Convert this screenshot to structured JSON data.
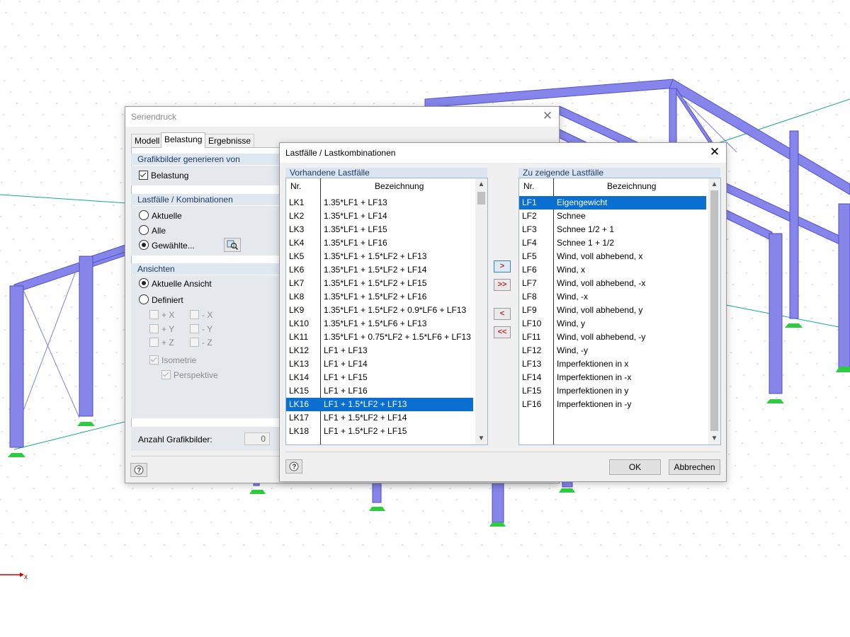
{
  "background": {
    "axis_label": "x",
    "colors": {
      "beam": "#7f7fe8",
      "support": "#2ecc40",
      "axis": "#d00000"
    }
  },
  "seriendruck": {
    "title": "Seriendruck",
    "tabs": [
      {
        "label": "Modell",
        "active": false
      },
      {
        "label": "Belastung",
        "active": true
      },
      {
        "label": "Ergebnisse",
        "active": false
      }
    ],
    "grafikbilder": {
      "header": "Grafikbilder generieren von",
      "belastung_label": "Belastung",
      "belastung_checked": true
    },
    "lastfaelle": {
      "header": "Lastfälle / Kombinationen",
      "options": [
        "Aktuelle",
        "Alle",
        "Gewählte..."
      ],
      "selected": "Gewählte..."
    },
    "ansichten": {
      "header": "Ansichten",
      "aktuelle": "Aktuelle Ansicht",
      "definiert": "Definiert",
      "selected": "Aktuelle Ansicht",
      "dirs": [
        [
          "+ X",
          "- X"
        ],
        [
          "+ Y",
          "- Y"
        ],
        [
          "+ Z",
          "- Z"
        ]
      ],
      "isometrie": "Isometrie",
      "perspektive": "Perspektive"
    },
    "anzahl_label": "Anzahl Grafikbilder:",
    "anzahl_value": "0"
  },
  "lastfaelle_dialog": {
    "title": "Lastfälle / Lastkombinationen",
    "left": {
      "header": "Vorhandene Lastfälle",
      "col_nr": "Nr.",
      "col_bez": "Bezeichnung",
      "selected_nr": "LK16",
      "rows": [
        [
          "LK1",
          "1.35*LF1 + LF13"
        ],
        [
          "LK2",
          "1.35*LF1 + LF14"
        ],
        [
          "LK3",
          "1.35*LF1 + LF15"
        ],
        [
          "LK4",
          "1.35*LF1 + LF16"
        ],
        [
          "LK5",
          "1.35*LF1 + 1.5*LF2 + LF13"
        ],
        [
          "LK6",
          "1.35*LF1 + 1.5*LF2 + LF14"
        ],
        [
          "LK7",
          "1.35*LF1 + 1.5*LF2 + LF15"
        ],
        [
          "LK8",
          "1.35*LF1 + 1.5*LF2 + LF16"
        ],
        [
          "LK9",
          "1.35*LF1 + 1.5*LF2 + 0.9*LF6 + LF13"
        ],
        [
          "LK10",
          "1.35*LF1 + 1.5*LF6 + LF13"
        ],
        [
          "LK11",
          "1.35*LF1 + 0.75*LF2 + 1.5*LF6 + LF13"
        ],
        [
          "LK12",
          "LF1 + LF13"
        ],
        [
          "LK13",
          "LF1 + LF14"
        ],
        [
          "LK14",
          "LF1 + LF15"
        ],
        [
          "LK15",
          "LF1 + LF16"
        ],
        [
          "LK16",
          "LF1 + 1.5*LF2 + LF13"
        ],
        [
          "LK17",
          "LF1 + 1.5*LF2 + LF14"
        ],
        [
          "LK18",
          "LF1 + 1.5*LF2 + LF15"
        ]
      ]
    },
    "right": {
      "header": "Zu zeigende Lastfälle",
      "col_nr": "Nr.",
      "col_bez": "Bezeichnung",
      "selected_nr": "LF1",
      "rows": [
        [
          "LF1",
          "Eigengewicht"
        ],
        [
          "LF2",
          "Schnee"
        ],
        [
          "LF3",
          "Schnee 1/2 + 1"
        ],
        [
          "LF4",
          "Schnee 1 + 1/2"
        ],
        [
          "LF5",
          "Wind, voll abhebend, x"
        ],
        [
          "LF6",
          "Wind, x"
        ],
        [
          "LF7",
          "Wind, voll abhebend, -x"
        ],
        [
          "LF8",
          "Wind, -x"
        ],
        [
          "LF9",
          "Wind, voll abhebend, y"
        ],
        [
          "LF10",
          "Wind, y"
        ],
        [
          "LF11",
          "Wind, voll abhebend, -y"
        ],
        [
          "LF12",
          "Wind, -y"
        ],
        [
          "LF13",
          "Imperfektionen in x"
        ],
        [
          "LF14",
          "Imperfektionen in -x"
        ],
        [
          "LF15",
          "Imperfektionen in y"
        ],
        [
          "LF16",
          "Imperfektionen in -y"
        ]
      ]
    },
    "move_buttons": [
      ">",
      ">>",
      "<",
      "<<"
    ],
    "ok_label": "OK",
    "cancel_label": "Abbrechen"
  }
}
